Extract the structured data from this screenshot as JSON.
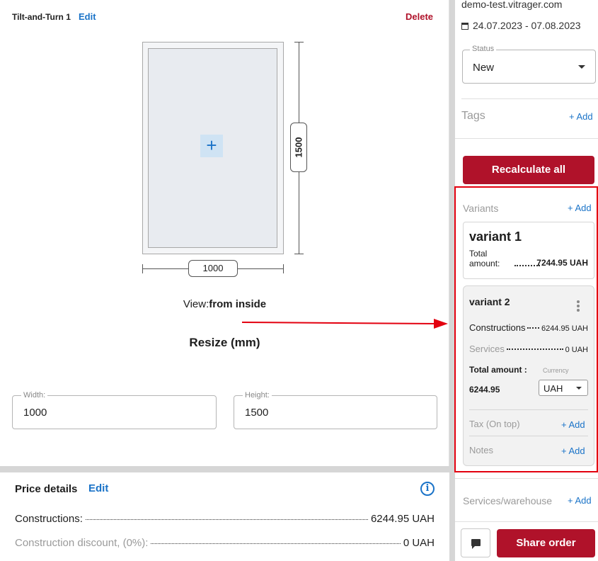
{
  "construction": {
    "title": "Tilt-and-Turn 1",
    "edit_label": "Edit",
    "delete_label": "Delete",
    "width_badge": "1000",
    "height_badge": "1500",
    "plus_glyph": "+",
    "view_prefix": "View:",
    "view_value": "from inside",
    "resize_title": "Resize (mm)",
    "width_field": {
      "label": "Width:",
      "value": "1000"
    },
    "height_field": {
      "label": "Height:",
      "value": "1500"
    }
  },
  "price_details": {
    "title": "Price details",
    "edit_label": "Edit",
    "info_glyph": "i",
    "rows": [
      {
        "label": "Constructions:",
        "value": "6244.95 UAH",
        "muted": false
      },
      {
        "label": "Construction discount, (0%):",
        "value": "0 UAH",
        "muted": true
      }
    ]
  },
  "sidebar": {
    "domain": "demo-test.vitrager.com",
    "dates": "24.07.2023 - 07.08.2023",
    "status": {
      "label": "Status",
      "value": "New"
    },
    "tags_label": "Tags",
    "add_label": "+ Add",
    "recalc_label": "Recalculate all",
    "variants_label": "Variants",
    "variant1": {
      "name": "variant 1",
      "total_label": "Total amount:",
      "total_value": "7244.95 UAH"
    },
    "variant2": {
      "name": "variant 2",
      "constructions_label": "Constructions",
      "constructions_value": "6244.95 UAH",
      "services_label": "Services",
      "services_value": "0 UAH",
      "total_label": "Total amount :",
      "total_value": "6244.95",
      "currency_label": "Currency",
      "currency_value": "UAH",
      "tax_label": "Tax (On top)",
      "notes_label": "Notes"
    },
    "services_warehouse_label": "Services/warehouse",
    "share_label": "Share order"
  },
  "colors": {
    "accent_blue": "#1a73c8",
    "brand_red": "#b0122a",
    "highlight_red": "#e3000f"
  }
}
